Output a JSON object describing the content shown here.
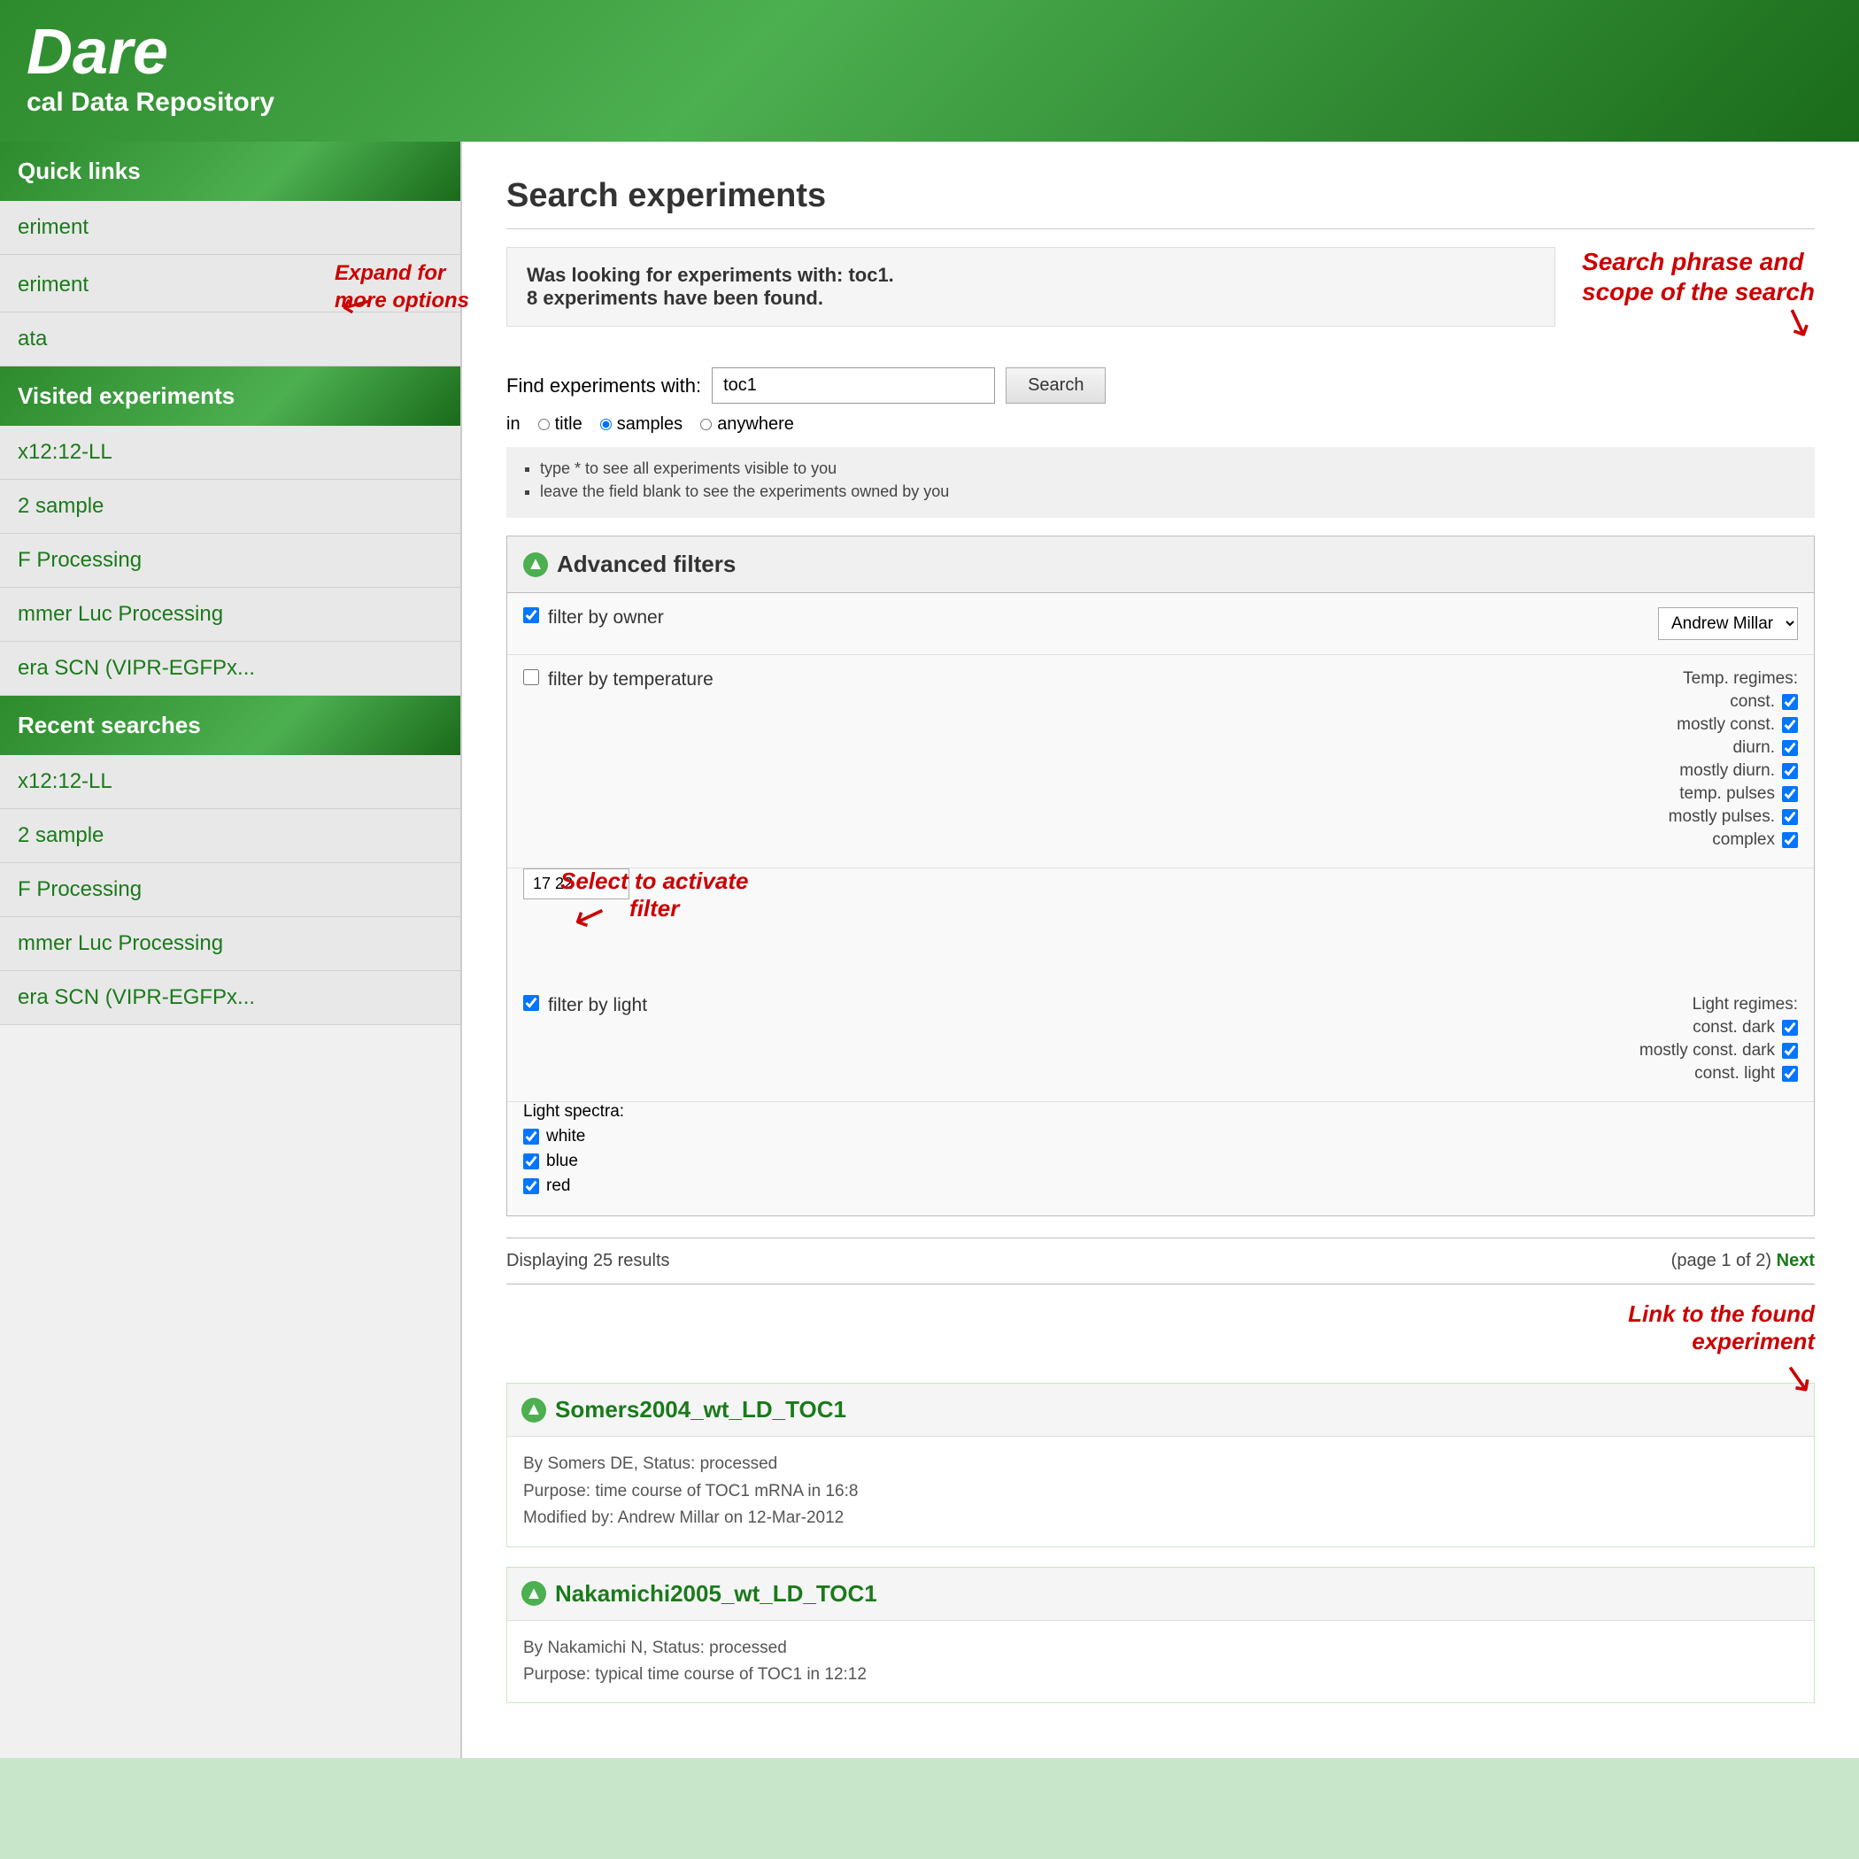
{
  "header": {
    "title": "Dare",
    "subtitle": "cal Data Repository"
  },
  "sidebar": {
    "quicklinks_title": "Quick links",
    "quicklinks_items": [
      {
        "label": "eriment"
      },
      {
        "label": "eriment"
      },
      {
        "label": "ata"
      }
    ],
    "expand_annotation": "Expand for\nmore options",
    "visited_title": "Visited experiments",
    "visited_items": [
      {
        "label": "x12:12-LL"
      },
      {
        "label": "2 sample"
      },
      {
        "label": "F Processing"
      },
      {
        "label": "mmer Luc Processing"
      },
      {
        "label": "era SCN (VIPR-EGFPx..."
      }
    ],
    "recent_title": "Recent searches",
    "recent_items": [
      {
        "label": "x12:12-LL"
      },
      {
        "label": "2 sample"
      },
      {
        "label": "F Processing"
      },
      {
        "label": "mmer Luc Processing"
      },
      {
        "label": "era SCN (VIPR-EGFPx..."
      }
    ]
  },
  "main": {
    "page_title": "Search experiments",
    "result_info_line1": "Was looking for experiments with: toc1.",
    "result_info_line2": "8 experiments have been found.",
    "callout_annotation": "Search phrase and\nscope of the search",
    "search_label": "Find experiments with:",
    "search_value": "toc1",
    "search_button": "Search",
    "radio_in_label": "in",
    "radio_title": "title",
    "radio_samples": "samples",
    "radio_anywhere": "anywhere",
    "hints": [
      "type * to see all experiments visible to you",
      "leave the field blank to see the experiments owned by you"
    ],
    "advanced_filters_title": "Advanced filters",
    "filter_owner_label": "filter by owner",
    "owner_value": "Andrew Millar",
    "filter_temp_label": "filter by temperature",
    "temp_value": "17 22",
    "temp_regimes_title": "Temp. regimes:",
    "temp_regimes": [
      {
        "label": "const.",
        "checked": true
      },
      {
        "label": "mostly const.",
        "checked": true
      },
      {
        "label": "diurn.",
        "checked": true
      },
      {
        "label": "mostly diurn.",
        "checked": true
      },
      {
        "label": "temp. pulses",
        "checked": true
      },
      {
        "label": "mostly pulses.",
        "checked": true
      },
      {
        "label": "complex",
        "checked": true
      }
    ],
    "select_annotation": "Select to activate\nfilter",
    "filter_light_label": "filter by light",
    "light_regimes_title": "Light regimes:",
    "light_regimes": [
      {
        "label": "const. dark",
        "checked": true
      },
      {
        "label": "mostly const. dark",
        "checked": true
      },
      {
        "label": "const. light",
        "checked": true
      }
    ],
    "light_spectra_label": "Light spectra:",
    "light_spectra": [
      {
        "label": "white",
        "checked": true
      },
      {
        "label": "blue",
        "checked": true
      },
      {
        "label": "red",
        "checked": true
      }
    ],
    "results_display": "Displaying 25 results",
    "pagination_text": "(page 1 of 2)",
    "pagination_next": "Next",
    "link_annotation": "Link to the found\nexperiment",
    "experiments": [
      {
        "id": "exp1",
        "title": "Somers2004_wt_LD_TOC1",
        "author": "By Somers DE, Status: processed",
        "purpose": "Purpose: time course of TOC1 mRNA in 16:8",
        "modified": "Modified by: Andrew Millar on 12-Mar-2012"
      },
      {
        "id": "exp2",
        "title": "Nakamichi2005_wt_LD_TOC1",
        "author": "By Nakamichi N, Status: processed",
        "purpose": "Purpose: typical time course of TOC1 in 12:12"
      }
    ]
  }
}
